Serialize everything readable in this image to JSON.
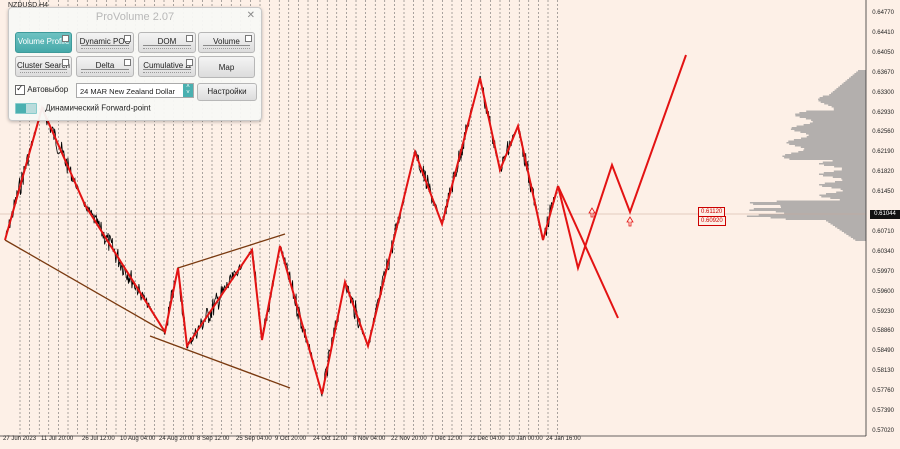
{
  "symbol": "NZDUSD,H4",
  "price_axis": [
    "0.64770",
    "0.64410",
    "0.64050",
    "0.63670",
    "0.63300",
    "0.62930",
    "0.62560",
    "0.62190",
    "0.61820",
    "0.61450",
    "0.61044",
    "0.60710",
    "0.60340",
    "0.59970",
    "0.59600",
    "0.59230",
    "0.58860",
    "0.58490",
    "0.58130",
    "0.57760",
    "0.57390",
    "0.57020"
  ],
  "current_price": "0.61044",
  "date_axis": [
    "27 Jun 2023",
    "11 Jul 20:00",
    "26 Jul 12:00",
    "10 Aug 04:00",
    "24 Aug 20:00",
    "8 Sep 12:00",
    "25 Sep 04:00",
    "9 Oct 20:00",
    "24 Oct 12:00",
    "8 Nov 04:00",
    "22 Nov 20:00",
    "7 Dec 12:00",
    "22 Dec 04:00",
    "10 Jan 00:00",
    "24 Jan 16:00"
  ],
  "levels": {
    "upper": "0.61120",
    "lower": "0.60920"
  },
  "colors": {
    "background": "#fdf0e7",
    "price": "#000000",
    "zigzag": "#e31313",
    "channel": "#7a3a10",
    "profile": "#9a9a9a",
    "accent": "#4ab0b0"
  },
  "panel": {
    "title": "ProVolume 2.07",
    "close_icon": "✕",
    "buttons": [
      "Volume Profile",
      "Dynamic POC",
      "DOM",
      "Volume",
      "Cluster Search",
      "Delta",
      "Cumulative Δ",
      "Map"
    ],
    "active_button": "Volume Profile",
    "auto_select_label": "Автовыбор",
    "auto_select_checked": true,
    "instrument": "24 MAR New Zealand Dollar",
    "settings_label": "Настройки",
    "forward_point_label": "Динамический Forward-point"
  }
}
